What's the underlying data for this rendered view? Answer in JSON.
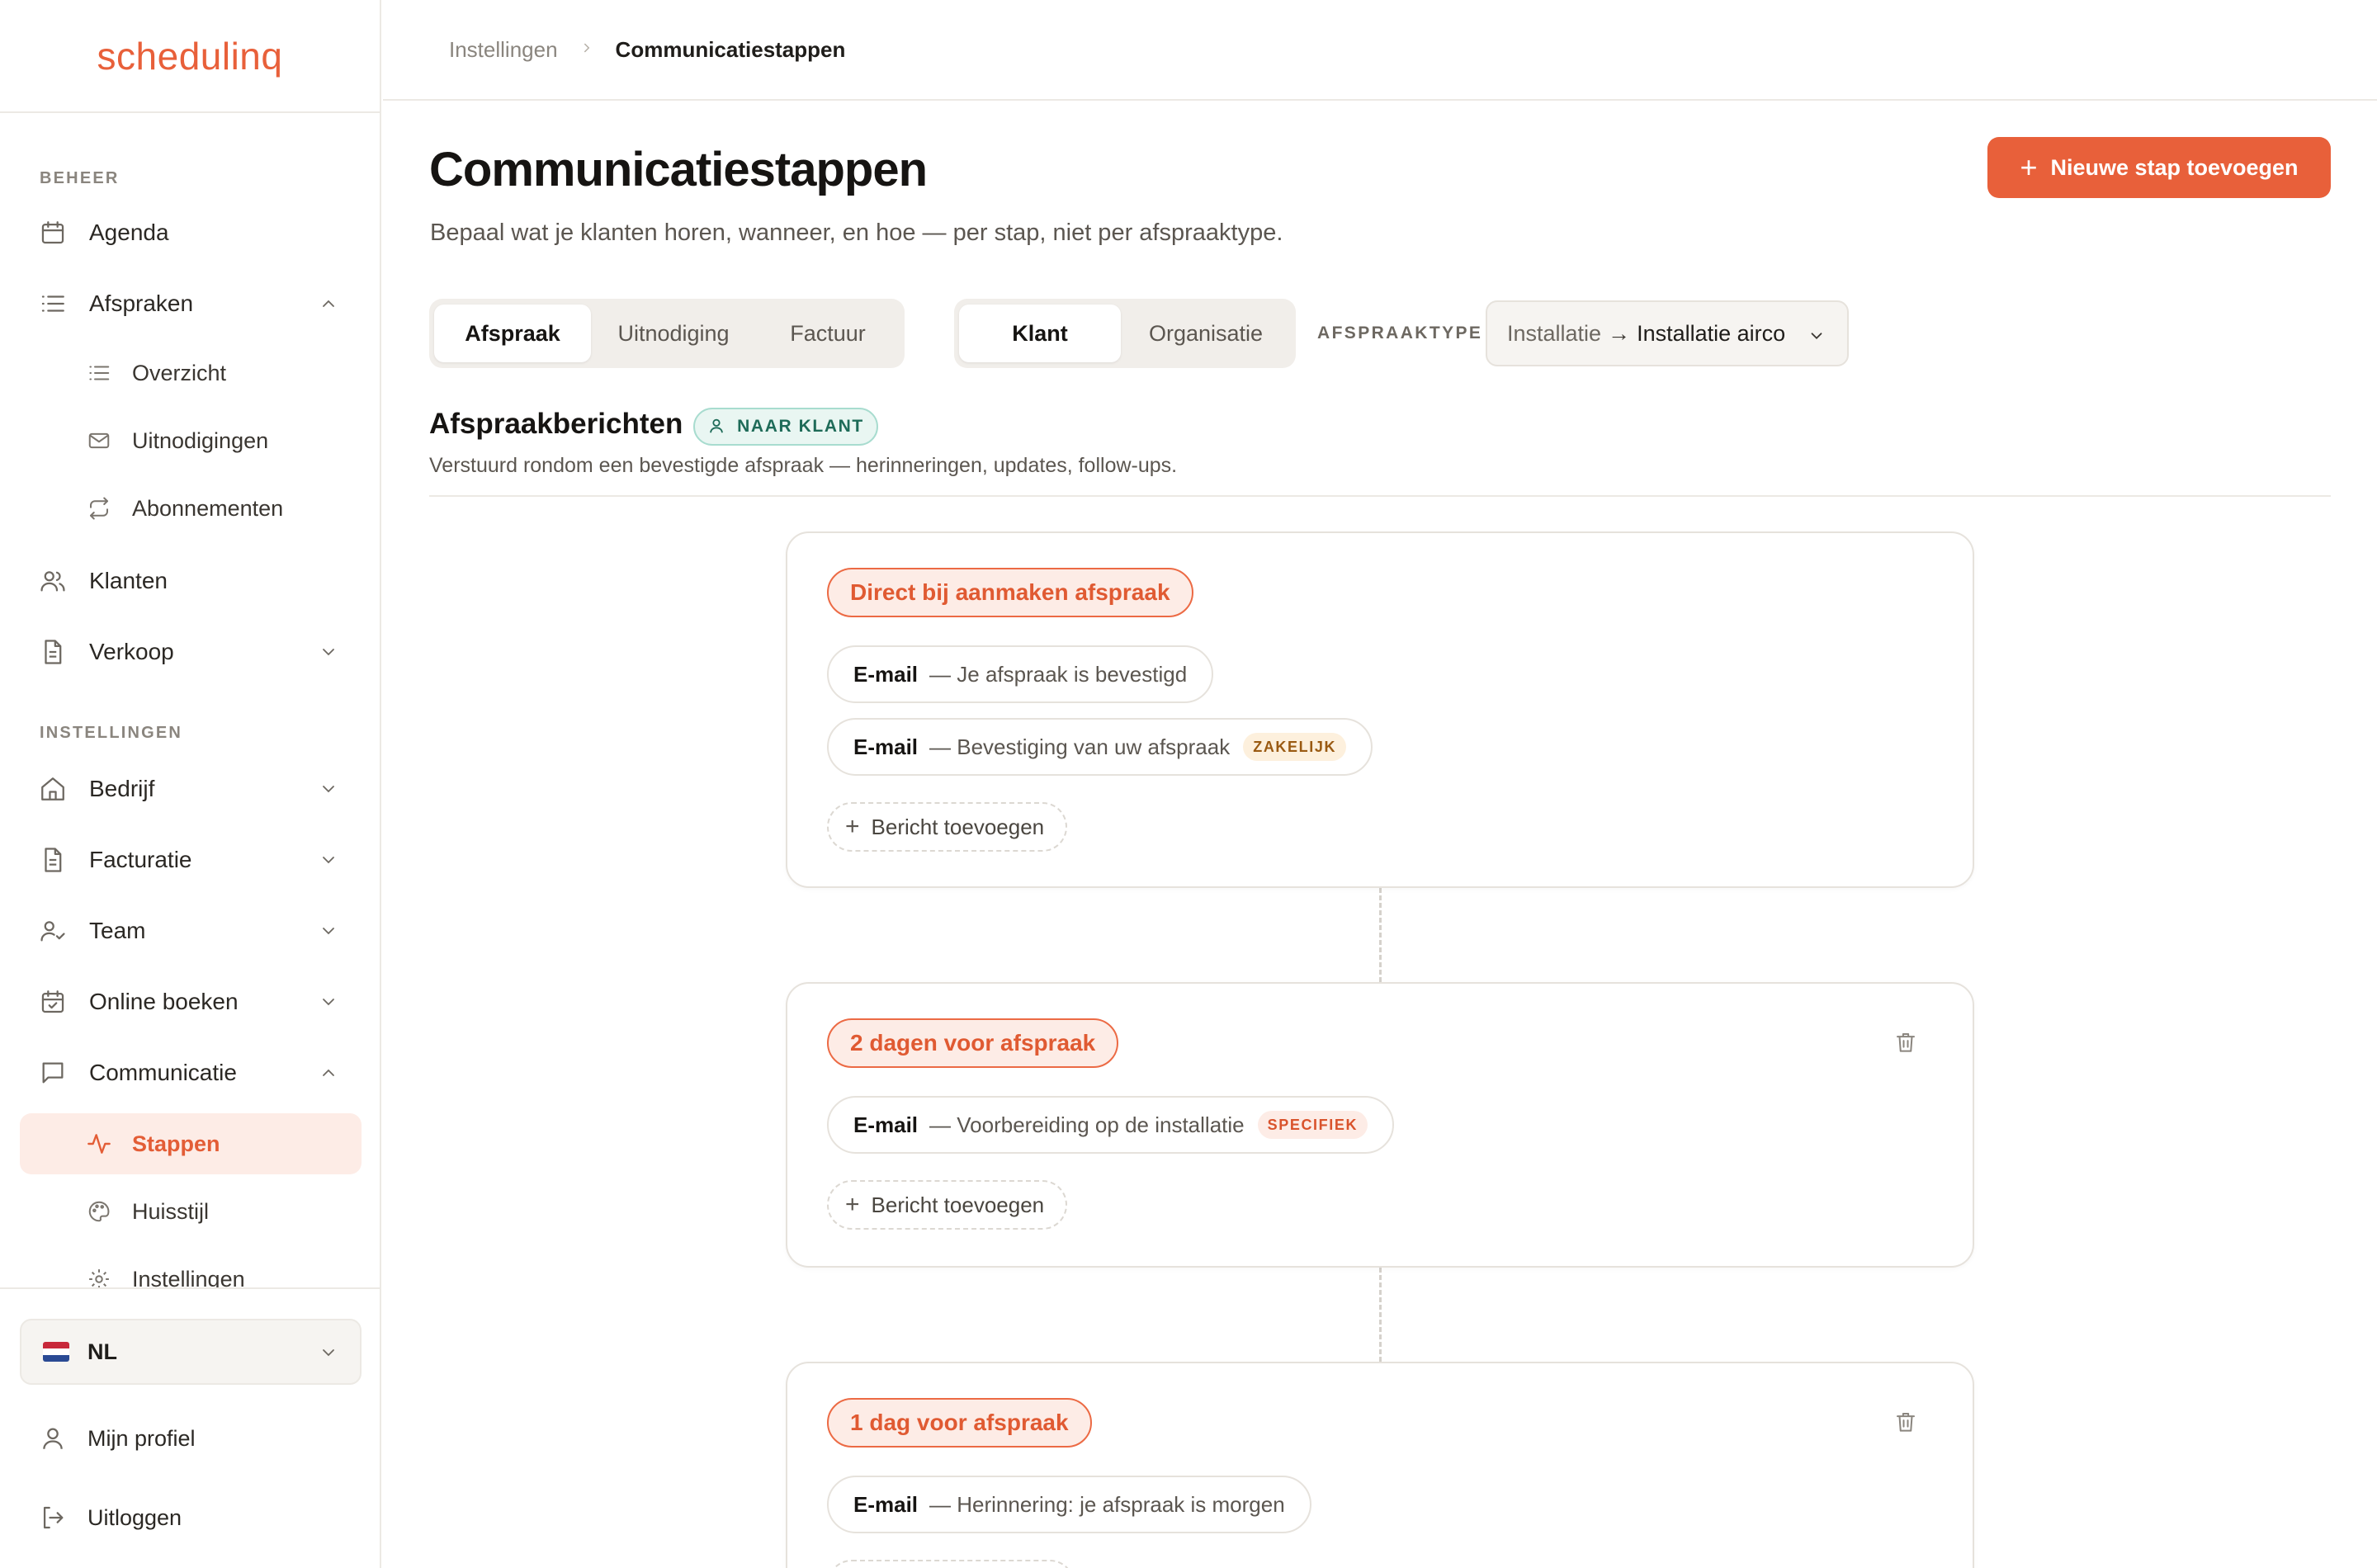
{
  "app": {
    "logo": "schedulinq",
    "accent": "#e8603a"
  },
  "sidebar": {
    "sections": {
      "beheer": "BEHEER",
      "instellingen": "INSTELLINGEN"
    },
    "items": {
      "agenda": "Agenda",
      "afspraken": "Afspraken",
      "overzicht": "Overzicht",
      "uitnodigingen": "Uitnodigingen",
      "abonnementen": "Abonnementen",
      "klanten": "Klanten",
      "verkoop": "Verkoop",
      "bedrijf": "Bedrijf",
      "facturatie": "Facturatie",
      "team": "Team",
      "online_boeken": "Online boeken",
      "communicatie": "Communicatie",
      "stappen": "Stappen",
      "huisstijl": "Huisstijl",
      "instellingen": "Instellingen"
    },
    "language": "NL",
    "profile": "Mijn profiel",
    "logout": "Uitloggen"
  },
  "breadcrumb": {
    "parent": "Instellingen",
    "current": "Communicatiestappen"
  },
  "page": {
    "title": "Communicatiestappen",
    "subtitle": "Bepaal wat je klanten horen, wanneer, en hoe — per stap, niet per afspraaktype.",
    "new_step_button": "Nieuwe stap toevoegen"
  },
  "tabs": {
    "category": [
      "Afspraak",
      "Uitnodiging",
      "Factuur"
    ],
    "category_selected": "Afspraak",
    "audience": [
      "Klant",
      "Organisatie"
    ],
    "audience_selected": "Klant"
  },
  "filter": {
    "label": "AFSPRAAKTYPE",
    "parent": "Installatie",
    "arrow": "→",
    "value": "Installatie airco"
  },
  "section": {
    "title": "Afspraakberichten",
    "audience_badge": "NAAR KLANT",
    "description": "Verstuurd rondom een bevestigde afspraak — herinneringen, updates, follow-ups."
  },
  "steps": [
    {
      "timing": "Direct bij aanmaken afspraak",
      "messages": [
        {
          "channel": "E-mail",
          "text": "— Je afspraak is bevestigd"
        },
        {
          "channel": "E-mail",
          "text": "— Bevestiging van uw afspraak",
          "tag": "ZAKELIJK"
        }
      ],
      "add_label": "Bericht toevoegen"
    },
    {
      "timing": "2 dagen voor afspraak",
      "messages": [
        {
          "channel": "E-mail",
          "text": "— Voorbereiding op de installatie",
          "tag": "SPECIFIEK"
        }
      ],
      "add_label": "Bericht toevoegen"
    },
    {
      "timing": "1 dag voor afspraak",
      "messages": [
        {
          "channel": "E-mail",
          "text": "— Herinnering: je afspraak is morgen"
        }
      ]
    }
  ]
}
